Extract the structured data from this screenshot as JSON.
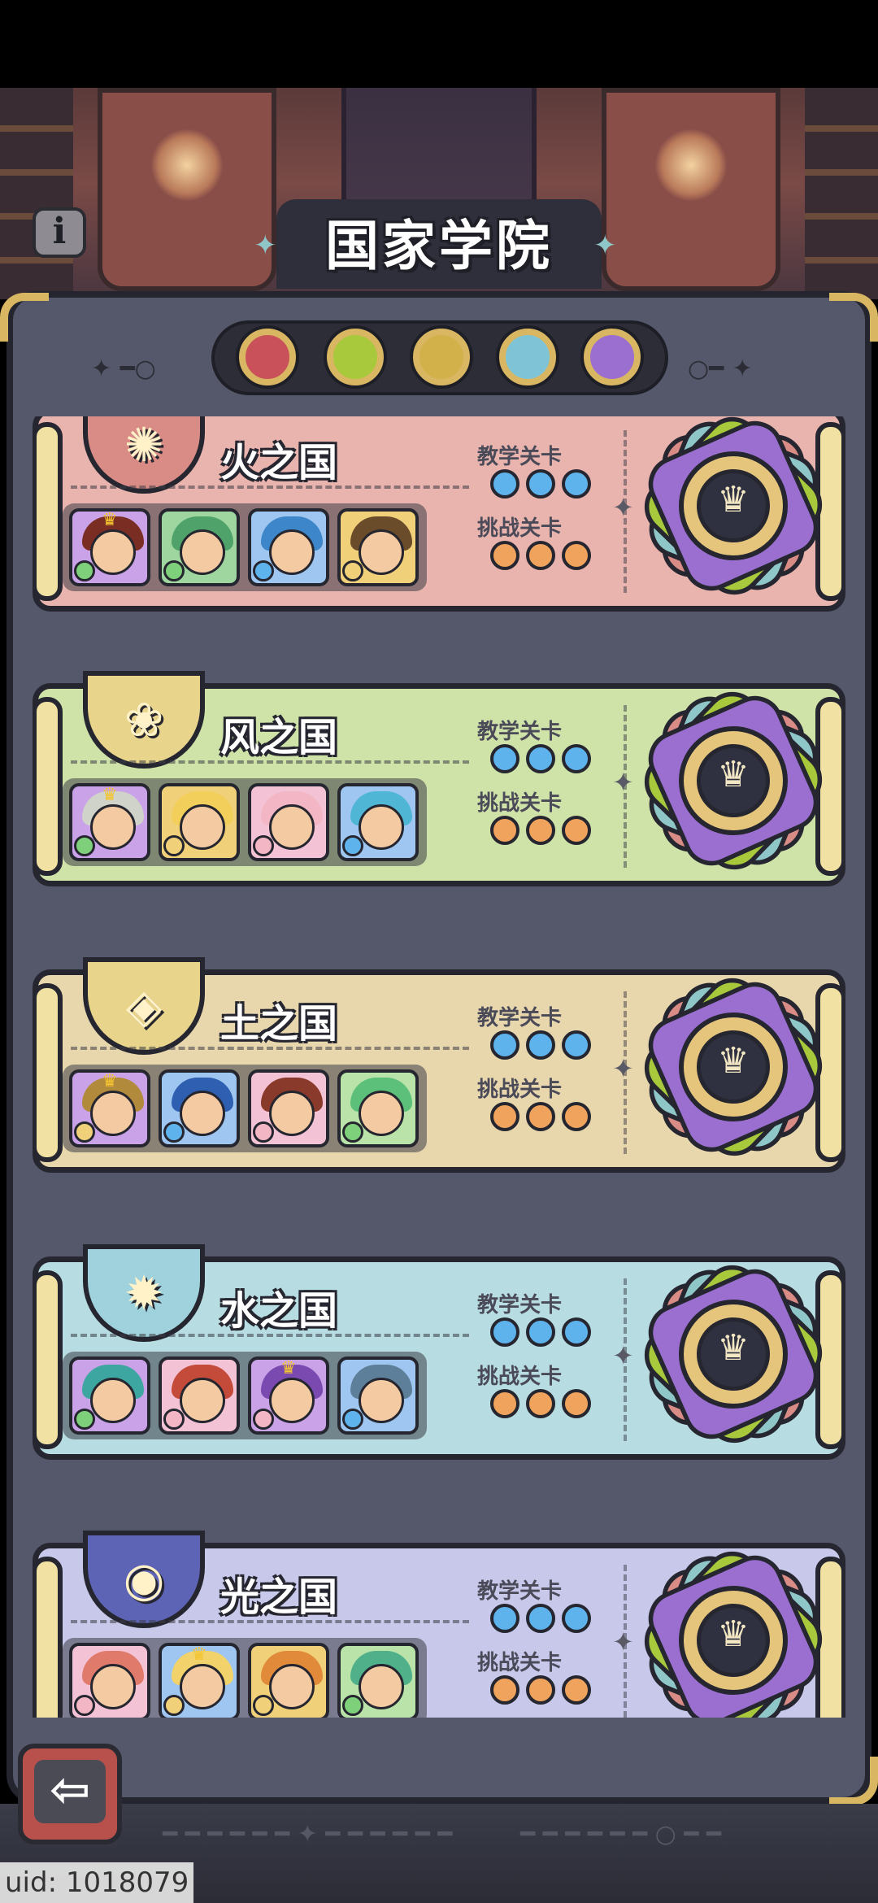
{
  "header": {
    "title": "国家学院",
    "info_icon": "info-icon"
  },
  "filters": [
    {
      "name": "fire",
      "color": "#c9525a"
    },
    {
      "name": "wind",
      "color": "#a8c93c"
    },
    {
      "name": "earth",
      "color": "#d3b14a"
    },
    {
      "name": "water",
      "color": "#7fc4d6"
    },
    {
      "name": "light",
      "color": "#9a6fd0"
    }
  ],
  "nations": [
    {
      "name": "火之国",
      "bg": "#e9b3ae",
      "emblem_bg": "#d98b86",
      "emblem_icon": "sun-gear-icon",
      "emblem_glyph": "✺",
      "teaching_label": "教学关卡",
      "challenge_label": "挑战关卡",
      "heroes": [
        {
          "hair": "#7a2d22",
          "frame": "#c9a2e8",
          "elem": "#7fd07a",
          "crown": true
        },
        {
          "hair": "#4fa36a",
          "frame": "#9fd6a0",
          "elem": "#7fd07a",
          "crown": false
        },
        {
          "hair": "#3d86c9",
          "frame": "#9fc6f0",
          "elem": "#5fb3ec",
          "crown": false
        },
        {
          "hair": "#6a4b2a",
          "frame": "#f1d07a",
          "elem": "#f1d07a",
          "crown": false
        }
      ]
    },
    {
      "name": "风之国",
      "bg": "#cfe3a8",
      "emblem_bg": "#e8d48a",
      "emblem_icon": "flame-spiral-icon",
      "emblem_glyph": "❀",
      "teaching_label": "教学关卡",
      "challenge_label": "挑战关卡",
      "heroes": [
        {
          "hair": "#cfd3c9",
          "frame": "#c9a2e8",
          "elem": "#7fd07a",
          "crown": true
        },
        {
          "hair": "#f2cf5a",
          "frame": "#f1d07a",
          "elem": "#f1d07a",
          "crown": false
        },
        {
          "hair": "#f3b6c4",
          "frame": "#f3c3d5",
          "elem": "#f3b6c4",
          "crown": false
        },
        {
          "hair": "#4fb6d6",
          "frame": "#9fc6f0",
          "elem": "#5fb3ec",
          "crown": false
        }
      ]
    },
    {
      "name": "土之国",
      "bg": "#e8d7ad",
      "emblem_bg": "#e8d48a",
      "emblem_icon": "diamond-stone-icon",
      "emblem_glyph": "◈",
      "teaching_label": "教学关卡",
      "challenge_label": "挑战关卡",
      "heroes": [
        {
          "hair": "#b28a3c",
          "frame": "#c9a2e8",
          "elem": "#f1d07a",
          "crown": true
        },
        {
          "hair": "#2f5fb0",
          "frame": "#9fc6f0",
          "elem": "#5fb3ec",
          "crown": false
        },
        {
          "hair": "#8a3a2a",
          "frame": "#f3c3d5",
          "elem": "#f3b6c4",
          "crown": false
        },
        {
          "hair": "#5cc07a",
          "frame": "#b9e3a8",
          "elem": "#7fd07a",
          "crown": false
        }
      ]
    },
    {
      "name": "水之国",
      "bg": "#b7dde2",
      "emblem_bg": "#9fd2dc",
      "emblem_icon": "water-swirl-icon",
      "emblem_glyph": "✹",
      "teaching_label": "教学关卡",
      "challenge_label": "挑战关卡",
      "heroes": [
        {
          "hair": "#3ea6a0",
          "frame": "#c9a2e8",
          "elem": "#7fd07a",
          "crown": false
        },
        {
          "hair": "#c44a3a",
          "frame": "#f3c3d5",
          "elem": "#f3b6c4",
          "crown": false
        },
        {
          "hair": "#7a4ab0",
          "frame": "#c9a2e8",
          "elem": "#f3b6c4",
          "crown": true
        },
        {
          "hair": "#5e7f99",
          "frame": "#9fc6f0",
          "elem": "#5fb3ec",
          "crown": false
        }
      ]
    },
    {
      "name": "光之国",
      "bg": "#c7c8ea",
      "emblem_bg": "#5e64b5",
      "emblem_icon": "planet-orb-icon",
      "emblem_glyph": "◉",
      "teaching_label": "教学关卡",
      "challenge_label": "挑战关卡",
      "heroes": [
        {
          "hair": "#e07a6a",
          "frame": "#f3c3d5",
          "elem": "#f3b6c4",
          "crown": false
        },
        {
          "hair": "#f2d26a",
          "frame": "#9fc6f0",
          "elem": "#f1d07a",
          "crown": true
        },
        {
          "hair": "#e08a3a",
          "frame": "#f1d07a",
          "elem": "#f1d07a",
          "crown": false
        },
        {
          "hair": "#4fb08a",
          "frame": "#b9e3a8",
          "elem": "#7fd07a",
          "crown": false
        }
      ]
    }
  ],
  "footer": {
    "back_icon": "back-arrow-icon",
    "back_glyph": "⇦",
    "uid_text": "uid: 1018079"
  }
}
